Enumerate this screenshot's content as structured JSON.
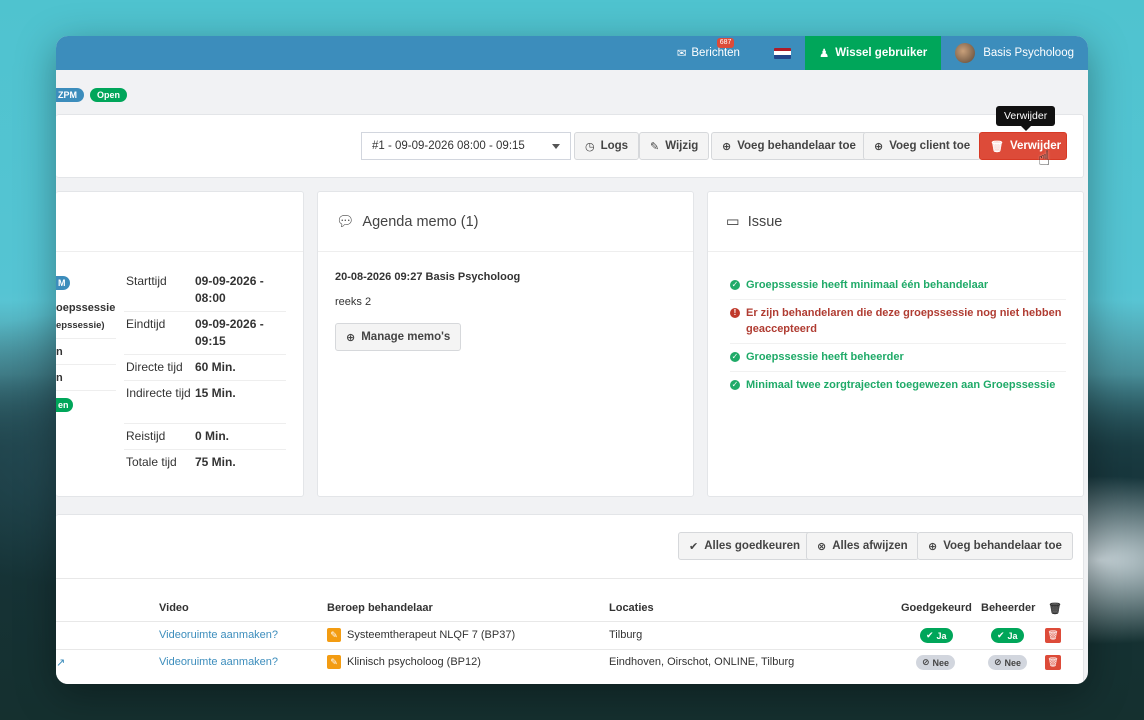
{
  "topbar": {
    "messages_label": "Berichten",
    "messages_count": "687",
    "switch_user_label": "Wissel gebruiker",
    "user_name": "Basis Psycholoog"
  },
  "tags": [
    "ZPM",
    "Open"
  ],
  "toolbar": {
    "session_select": "#1 - 09-09-2026 08:00 - 09:15",
    "logs": "Logs",
    "edit": "Wijzig",
    "add_practitioner": "Voeg behandelaar toe",
    "add_client": "Voeg client toe",
    "delete": "Verwijder",
    "tooltip": "Verwijder"
  },
  "details": {
    "left_clipped": [
      "M",
      "oepssessie",
      "epssessie)",
      "n",
      "n",
      "en"
    ],
    "rows": [
      {
        "label": "Starttijd",
        "value": "09-09-2026 - 08:00"
      },
      {
        "label": "Eindtijd",
        "value": "09-09-2026 - 09:15"
      },
      {
        "label": "Directe tijd",
        "value": "60 Min."
      },
      {
        "label": "Indirecte tijd",
        "value": "15 Min."
      },
      {
        "label": "Reistijd",
        "value": "0 Min."
      },
      {
        "label": "Totale tijd",
        "value": "75 Min."
      }
    ]
  },
  "memo": {
    "title": "Agenda memo (1)",
    "author_line": "20-08-2026 09:27 Basis Psycholoog",
    "text": "reeks 2",
    "manage_button": "Manage memo's"
  },
  "issue": {
    "title": "Issue",
    "items": [
      {
        "status": "ok",
        "text": "Groepssessie heeft minimaal één behandelaar"
      },
      {
        "status": "error",
        "text": "Er zijn behandelaren die deze groepssessie nog niet hebben geaccepteerd"
      },
      {
        "status": "ok",
        "text": "Groepssessie heeft beheerder"
      },
      {
        "status": "ok",
        "text": "Minimaal twee zorgtrajecten toegewezen aan Groepssessie"
      }
    ]
  },
  "practitioners": {
    "approve_all": "Alles goedkeuren",
    "reject_all": "Alles afwijzen",
    "add_practitioner": "Voeg behandelaar toe",
    "columns": {
      "video": "Video",
      "profession": "Beroep behandelaar",
      "locations": "Locaties",
      "approved": "Goedgekeurd",
      "manager": "Beheerder"
    },
    "rows": [
      {
        "video": "Videoruimte aanmaken?",
        "profession": "Systeemtherapeut NLQF 7 (BP37)",
        "locations": "Tilburg",
        "approved": "Ja",
        "manager": "Ja"
      },
      {
        "video": "Videoruimte aanmaken?",
        "profession": "Klinisch psycholoog (BP12)",
        "locations": "Eindhoven, Oirschot, ONLINE, Tilburg",
        "approved": "Nee",
        "manager": "Nee"
      }
    ]
  }
}
